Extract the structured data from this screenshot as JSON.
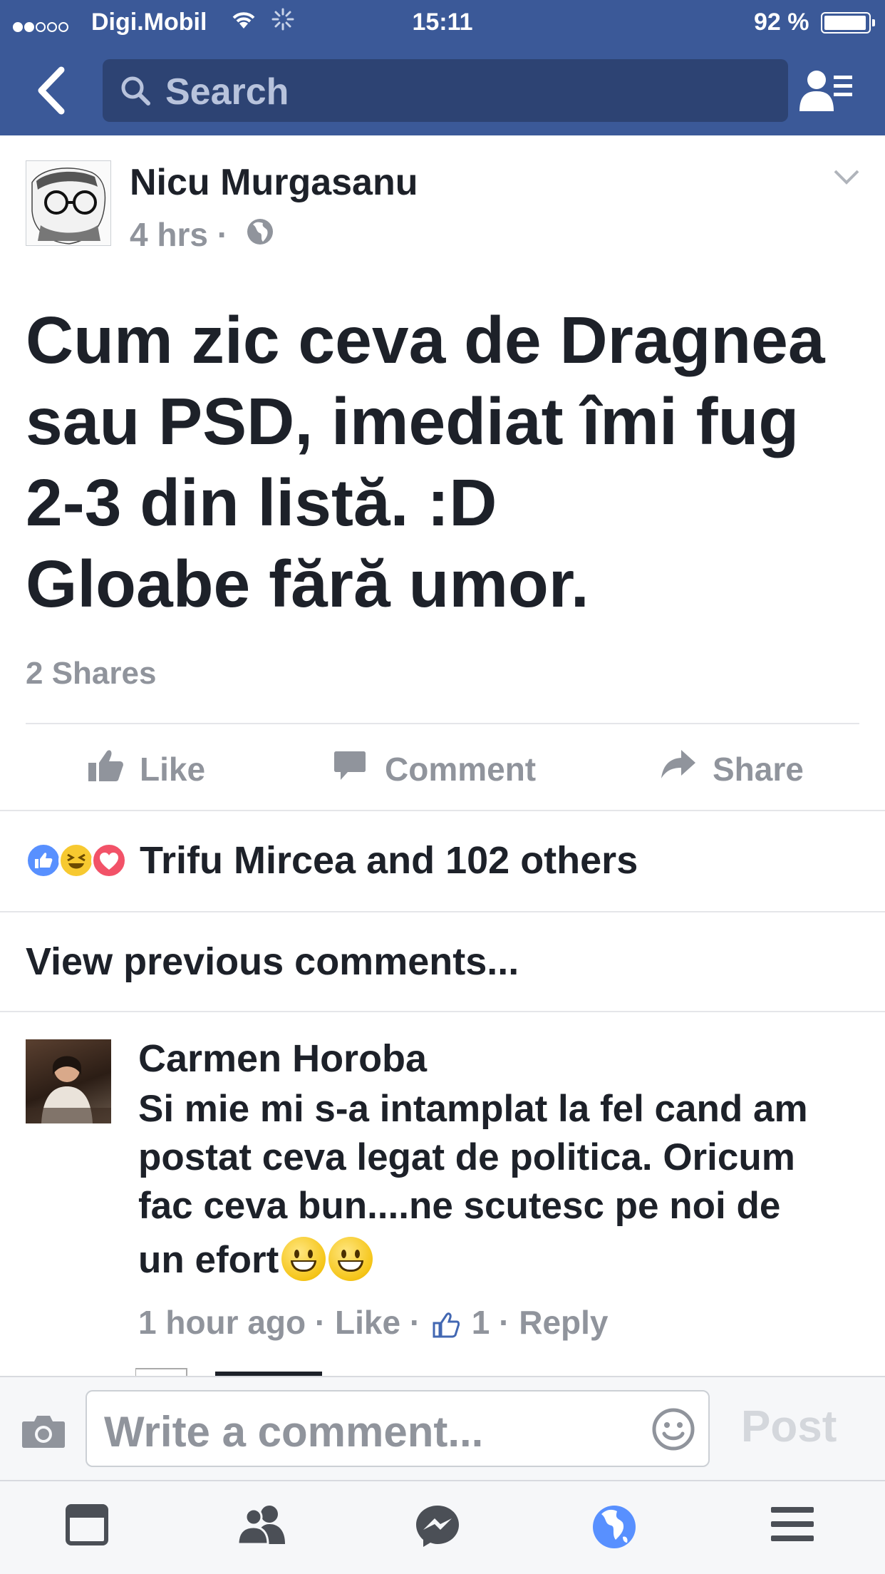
{
  "status_bar": {
    "carrier": "Digi.Mobil",
    "time": "15:11",
    "battery": "92 %",
    "battery_level": 0.92
  },
  "nav": {
    "search_placeholder": "Search"
  },
  "post": {
    "author": "Nicu Murgasanu",
    "time": "4 hrs",
    "separator": "·",
    "text_lines": [
      "Cum zic ceva de Dragnea",
      "sau PSD, imediat îmi fug",
      "2-3 din listă. :D",
      "Gloabe fără umor."
    ],
    "shares": "2 Shares",
    "actions": {
      "like": "Like",
      "comment": "Comment",
      "share": "Share"
    },
    "reactions_text": "Trifu Mircea and 102 others",
    "view_previous": "View previous comments..."
  },
  "comment": {
    "author": "Carmen Horoba",
    "lines": [
      "Si mie mi s-a intamplat la fel cand am",
      "postat ceva legat de politica. Oricum",
      "fac ceva bun....ne scutesc pe noi de",
      "un efort"
    ],
    "time": "1 hour ago",
    "like": "Like",
    "like_count": "1",
    "reply": "Reply",
    "dot": "·"
  },
  "composer": {
    "placeholder": "Write a comment...",
    "post": "Post"
  },
  "colors": {
    "brand": "#3b5998",
    "text": "#1d2129",
    "muted": "#90949c",
    "like_blue": "#5890ff",
    "love_red": "#f25268",
    "haha_yellow": "#f7c930"
  }
}
